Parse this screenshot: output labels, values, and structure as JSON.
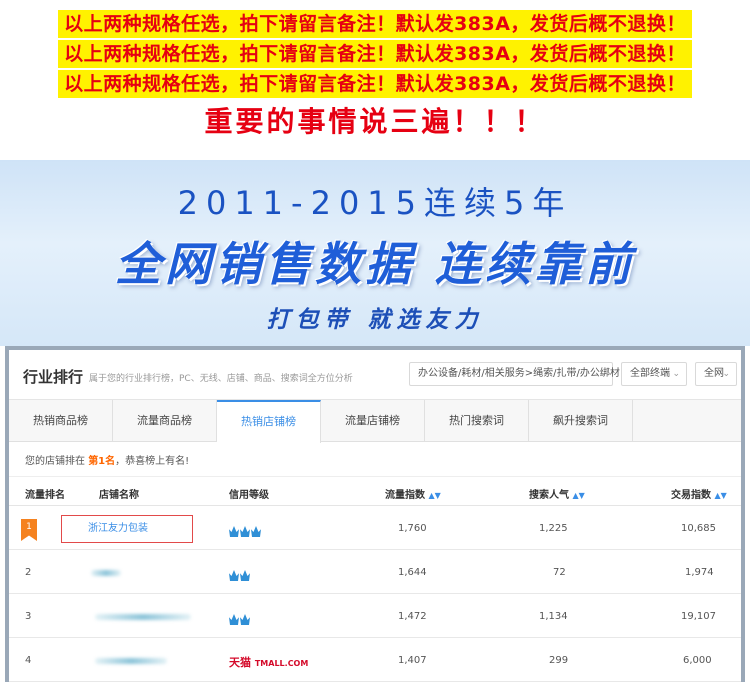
{
  "notice": {
    "lines": [
      "以上两种规格任选，拍下请留言备注！默认发383A，发货后概不退换！",
      "以上两种规格任选，拍下请留言备注！默认发383A，发货后概不退换！",
      "以上两种规格任选，拍下请留言备注！默认发383A，发货后概不退换！"
    ],
    "important": "重要的事情说三遍！！！"
  },
  "banner": {
    "years": "2011-2015连续5年",
    "main": "全网销售数据 连续靠前",
    "sub": "打包带 就选友力"
  },
  "panel": {
    "title": "行业排行",
    "description": "属于您的行业排行榜，PC、无线、店铺、商品、搜索词全方位分析",
    "category_select": "办公设备/耗材/相关服务>绳索/扎带/办公绑材",
    "terminal_select": "全部终端",
    "scope_select": "全网",
    "tabs": [
      "热销商品榜",
      "流量商品榜",
      "热销店铺榜",
      "流量店铺榜",
      "热门搜索词",
      "飙升搜索词"
    ],
    "active_tab": 2,
    "rank_info_prefix": "您的店铺排在",
    "rank_info_rank": "第1名",
    "rank_info_suffix": "，恭喜榜上有名!",
    "columns": {
      "rank": "流量排名",
      "shop": "店铺名称",
      "credit": "信用等级",
      "traffic": "流量指数",
      "search": "搜索人气",
      "trade": "交易指数"
    },
    "rows": [
      {
        "rank": "1",
        "shop": "浙江友力包装",
        "credit": "crowns-3",
        "traffic": "1,760",
        "search": "1,225",
        "trade": "10,685"
      },
      {
        "rank": "2",
        "shop": "",
        "credit": "crowns-2",
        "traffic": "1,644",
        "search": "72",
        "trade": "1,974"
      },
      {
        "rank": "3",
        "shop": "",
        "credit": "crowns-2",
        "traffic": "1,472",
        "search": "1,134",
        "trade": "19,107"
      },
      {
        "rank": "4",
        "shop": "",
        "credit": "tmall",
        "traffic": "1,407",
        "search": "299",
        "trade": "6,000"
      }
    ],
    "tmall_cn": "天猫",
    "tmall_en": "TMALL.COM",
    "colors": {
      "accent": "#3a8ee6",
      "badge": "#f5821f",
      "highlight": "#ff6600"
    }
  }
}
